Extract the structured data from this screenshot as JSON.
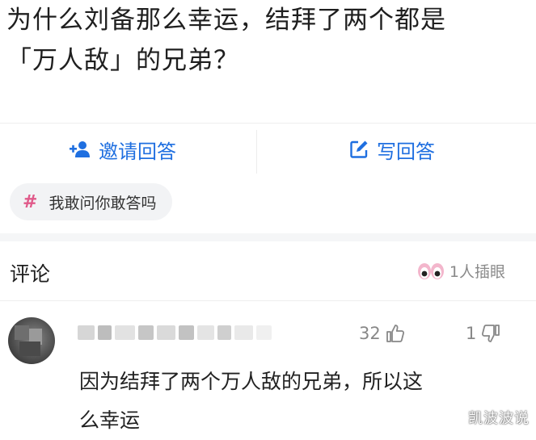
{
  "question": {
    "title_line1": "为什么刘备那么幸运，结拜了两个都是",
    "title_line2": "「万人敌」的兄弟？"
  },
  "actions": {
    "invite_label": "邀请回答",
    "write_label": "写回答"
  },
  "topic": {
    "hash": "#",
    "label": "我敢问你敢答吗"
  },
  "comments": {
    "title": "评论",
    "onlookers": "1人插眼",
    "items": [
      {
        "likes": "32",
        "dislikes": "1",
        "text_line1": "因为结拜了两个万人敌的兄弟，所以这",
        "text_line2": "么幸运"
      }
    ]
  },
  "watermark": "凯波波说",
  "colors": {
    "accent": "#1f6fe0",
    "tag_hash": "#e05a8a",
    "muted": "#888888"
  },
  "icons": [
    "add-person-icon",
    "edit-icon",
    "hashtag-icon",
    "eyes-icon",
    "thumbs-up-icon",
    "thumbs-down-icon"
  ]
}
